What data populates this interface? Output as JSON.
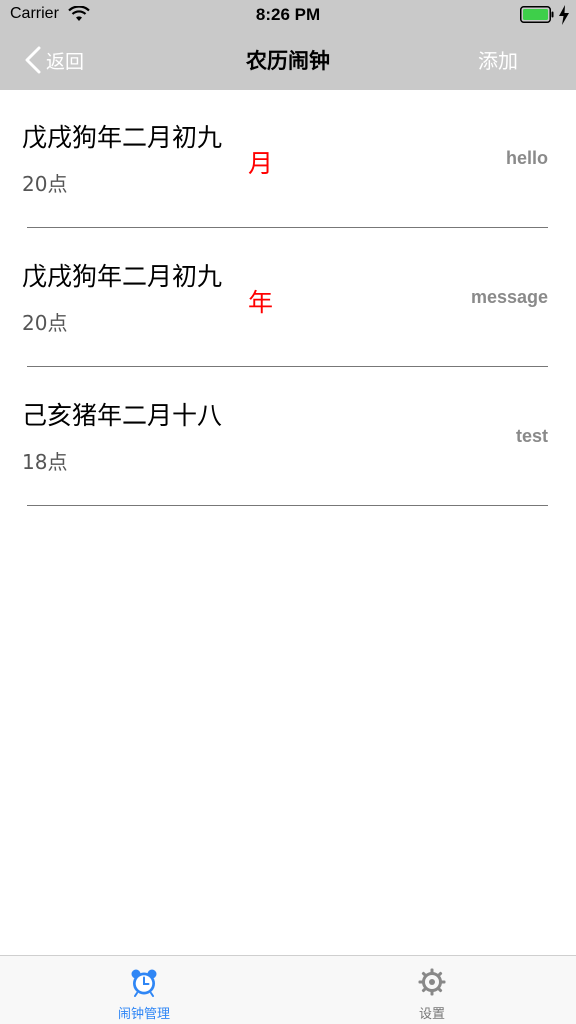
{
  "status_bar": {
    "carrier": "Carrier",
    "time": "8:26 PM",
    "wifi_icon": "wifi-icon",
    "battery_icon": "battery-icon",
    "charging_icon": "charging-bolt-icon"
  },
  "nav": {
    "back_label": "返回",
    "title": "农历闹钟",
    "add_label": "添加"
  },
  "alarms": [
    {
      "date": "戊戌狗年二月初九",
      "repeat": "月",
      "hour": "20点",
      "note": "hello"
    },
    {
      "date": "戊戌狗年二月初九",
      "repeat": "年",
      "hour": "20点",
      "note": "message"
    },
    {
      "date": "己亥猪年二月十八",
      "repeat": "",
      "hour": "18点",
      "note": "test"
    }
  ],
  "tabs": [
    {
      "label": "闹钟管理",
      "icon": "alarm-clock-icon",
      "active": true
    },
    {
      "label": "设置",
      "icon": "gear-icon",
      "active": false
    }
  ],
  "colors": {
    "bar_background": "#c9c9c9",
    "accent": "#2f86f5",
    "repeat_highlight": "#ff0000",
    "note_text": "#8a8a8a"
  }
}
